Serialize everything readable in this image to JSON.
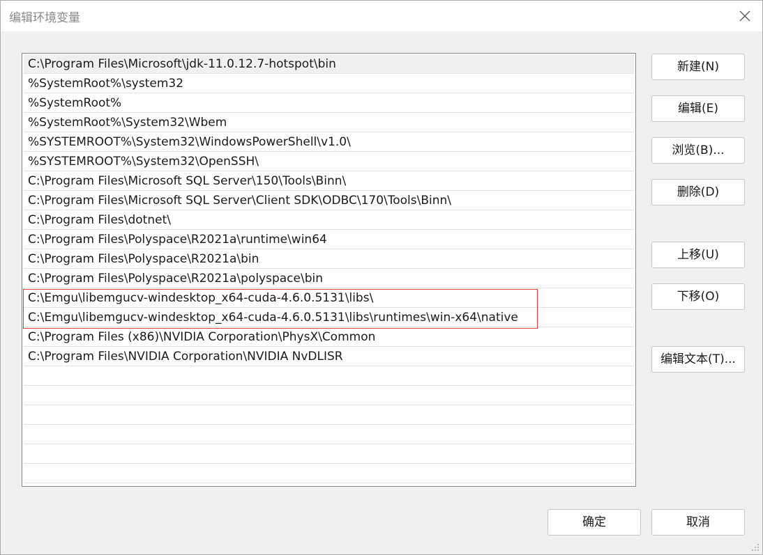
{
  "window": {
    "title": "编辑环境变量"
  },
  "paths": [
    "C:\\Program Files\\Microsoft\\jdk-11.0.12.7-hotspot\\bin",
    "%SystemRoot%\\system32",
    "%SystemRoot%",
    "%SystemRoot%\\System32\\Wbem",
    "%SYSTEMROOT%\\System32\\WindowsPowerShell\\v1.0\\",
    "%SYSTEMROOT%\\System32\\OpenSSH\\",
    "C:\\Program Files\\Microsoft SQL Server\\150\\Tools\\Binn\\",
    "C:\\Program Files\\Microsoft SQL Server\\Client SDK\\ODBC\\170\\Tools\\Binn\\",
    "C:\\Program Files\\dotnet\\",
    "C:\\Program Files\\Polyspace\\R2021a\\runtime\\win64",
    "C:\\Program Files\\Polyspace\\R2021a\\bin",
    "C:\\Program Files\\Polyspace\\R2021a\\polyspace\\bin",
    "C:\\Emgu\\libemgucv-windesktop_x64-cuda-4.6.0.5131\\libs\\",
    "C:\\Emgu\\libemgucv-windesktop_x64-cuda-4.6.0.5131\\libs\\runtimes\\win-x64\\native",
    "C:\\Program Files (x86)\\NVIDIA Corporation\\PhysX\\Common",
    "C:\\Program Files\\NVIDIA Corporation\\NVIDIA NvDLISR"
  ],
  "buttons": {
    "new": "新建(N)",
    "edit": "编辑(E)",
    "browse": "浏览(B)...",
    "delete": "删除(D)",
    "move_up": "上移(U)",
    "move_down": "下移(O)",
    "edit_text": "编辑文本(T)...",
    "ok": "确定",
    "cancel": "取消"
  },
  "colors": {
    "highlight_border": "#e0403a",
    "selected_row": "#f0f0f0"
  }
}
